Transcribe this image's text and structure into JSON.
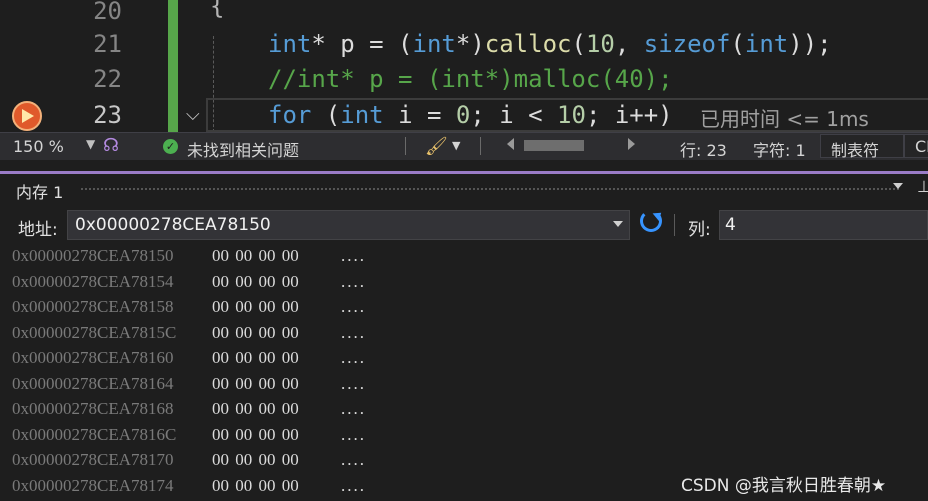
{
  "editor": {
    "lines": [
      {
        "num": "20"
      },
      {
        "num": "21"
      },
      {
        "num": "22"
      },
      {
        "num": "23"
      }
    ],
    "brace": "{",
    "perf_tip": "已用时间 <= 1ms"
  },
  "statusbar": {
    "zoom": "150 %",
    "issues": "未找到相关问题",
    "line": "行: 23",
    "char": "字符: 1",
    "tab_mode": "制表符",
    "line_ending": "CI"
  },
  "memory": {
    "title": "内存 1",
    "address_label": "地址:",
    "address_value": "0x00000278CEA78150",
    "columns_label": "列:",
    "columns_value": "4",
    "rows": [
      {
        "addr": "0x00000278CEA78150",
        "bytes": "00 00 00 00",
        "ascii": "...."
      },
      {
        "addr": "0x00000278CEA78154",
        "bytes": "00 00 00 00",
        "ascii": "...."
      },
      {
        "addr": "0x00000278CEA78158",
        "bytes": "00 00 00 00",
        "ascii": "...."
      },
      {
        "addr": "0x00000278CEA7815C",
        "bytes": "00 00 00 00",
        "ascii": "...."
      },
      {
        "addr": "0x00000278CEA78160",
        "bytes": "00 00 00 00",
        "ascii": "...."
      },
      {
        "addr": "0x00000278CEA78164",
        "bytes": "00 00 00 00",
        "ascii": "...."
      },
      {
        "addr": "0x00000278CEA78168",
        "bytes": "00 00 00 00",
        "ascii": "...."
      },
      {
        "addr": "0x00000278CEA7816C",
        "bytes": "00 00 00 00",
        "ascii": "...."
      },
      {
        "addr": "0x00000278CEA78170",
        "bytes": "00 00 00 00",
        "ascii": "...."
      },
      {
        "addr": "0x00000278CEA78174",
        "bytes": "00 00 00 00",
        "ascii": "...."
      }
    ]
  },
  "watermark": "CSDN @我言秋日胜春朝★",
  "colors": {
    "accent": "#9a7cc7",
    "keyword": "#569cd6",
    "function": "#dcdcaa",
    "number": "#b5cea8",
    "comment": "#57a64a"
  }
}
